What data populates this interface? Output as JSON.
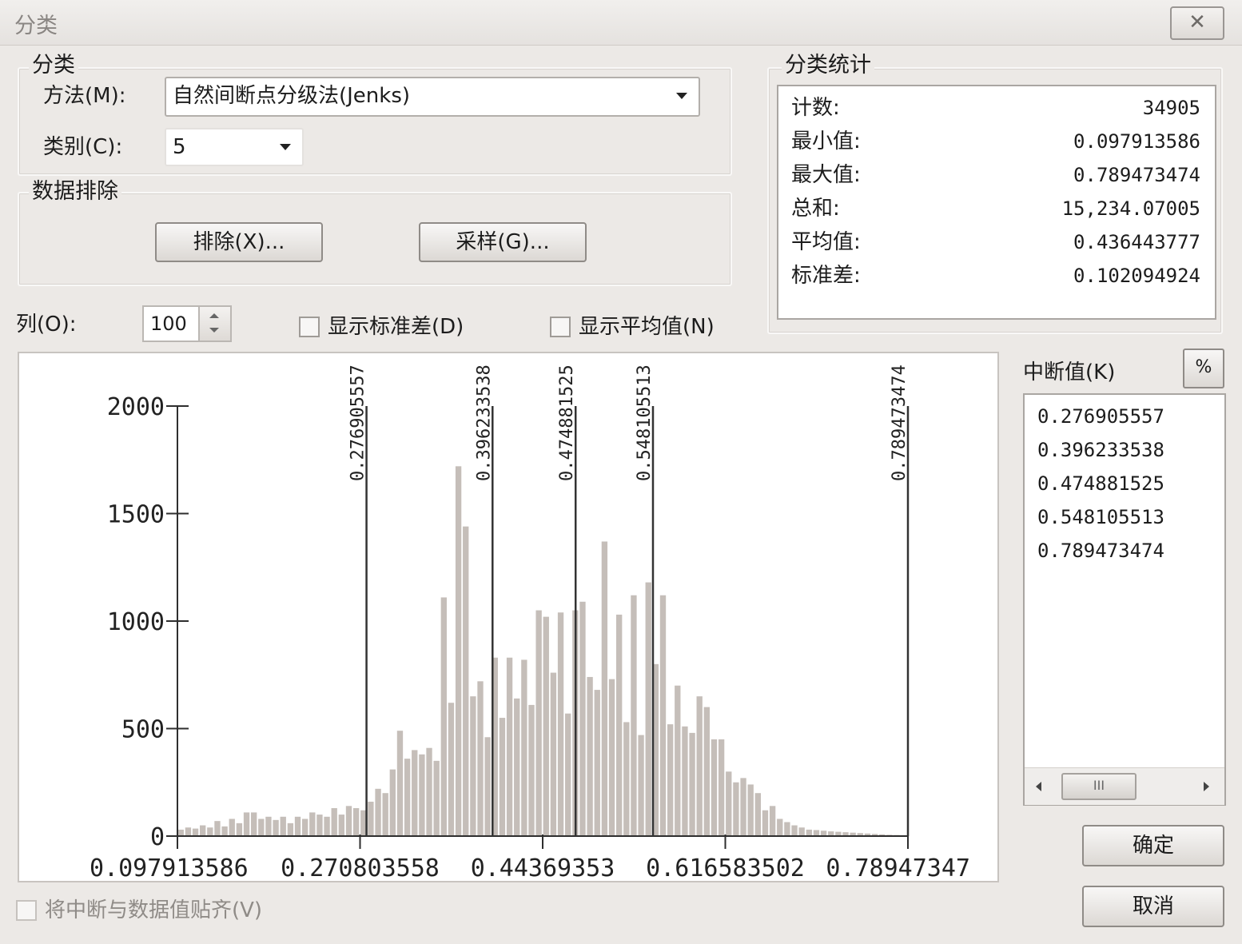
{
  "window": {
    "title": "分类",
    "close_glyph": "✕"
  },
  "classification": {
    "group_title": "分类",
    "method_label": "方法(M):",
    "method_value": "自然间断点分级法(Jenks)",
    "classes_label": "类别(C):",
    "classes_value": "5"
  },
  "exclusion": {
    "group_title": "数据排除",
    "exclude_button": "排除(X)...",
    "sampling_button": "采样(G)..."
  },
  "stats": {
    "group_title": "分类统计",
    "rows": [
      {
        "label": "计数:",
        "value": "34905"
      },
      {
        "label": "最小值:",
        "value": "0.097913586"
      },
      {
        "label": "最大值:",
        "value": "0.789473474"
      },
      {
        "label": "总和:",
        "value": "15,234.07005"
      },
      {
        "label": "平均值:",
        "value": "0.436443777"
      },
      {
        "label": "标准差:",
        "value": "0.102094924"
      }
    ]
  },
  "options": {
    "columns_label": "列(O):",
    "columns_value": "100",
    "show_std_label": "显示标准差(D)",
    "show_mean_label": "显示平均值(N)",
    "snap_label": "将中断与数据值贴齐(V)"
  },
  "breaks_panel": {
    "title": "中断值(K)",
    "percent_button": "%",
    "values": [
      "0.276905557",
      "0.396233538",
      "0.474881525",
      "0.548105513",
      "0.789473474"
    ],
    "scroll_thumb_glyph": "III"
  },
  "buttons": {
    "ok": "确定",
    "cancel": "取消"
  },
  "chart_data": {
    "type": "bar",
    "x_min": 0.097913586,
    "x_max": 0.789473474,
    "ylim": [
      0,
      2000
    ],
    "y_ticks": [
      0,
      500,
      1000,
      1500,
      2000
    ],
    "x_tick_values": [
      0.097913586,
      0.270803558,
      0.44369353,
      0.616583502,
      0.789473474
    ],
    "x_tick_labels": [
      "0.097913586",
      "0.270803558",
      "0.44369353",
      "0.616583502",
      "0.78947347"
    ],
    "breaks": [
      0.276905557,
      0.396233538,
      0.474881525,
      0.548105513,
      0.789473474
    ],
    "break_labels": [
      "0.276905557",
      "0.396233538",
      "0.474881525",
      "0.548105513",
      "0.789473474"
    ],
    "values": [
      30,
      40,
      35,
      50,
      40,
      70,
      45,
      80,
      60,
      110,
      110,
      80,
      90,
      75,
      90,
      60,
      90,
      80,
      110,
      100,
      90,
      130,
      100,
      140,
      130,
      120,
      160,
      220,
      200,
      310,
      490,
      360,
      400,
      380,
      410,
      350,
      1110,
      620,
      1720,
      1440,
      650,
      720,
      460,
      830,
      550,
      830,
      640,
      820,
      610,
      1050,
      1020,
      760,
      1040,
      570,
      1050,
      1090,
      740,
      680,
      1370,
      730,
      1030,
      530,
      1120,
      470,
      1180,
      800,
      1120,
      520,
      700,
      510,
      480,
      650,
      600,
      450,
      450,
      300,
      250,
      270,
      240,
      200,
      120,
      140,
      80,
      65,
      50,
      40,
      30,
      28,
      25,
      22,
      20,
      18,
      16,
      14,
      12,
      10,
      8,
      6,
      5,
      4
    ],
    "colors": {
      "bar": "#c5beb9",
      "axis": "#2e2e2e",
      "break_line": "#333333"
    }
  }
}
